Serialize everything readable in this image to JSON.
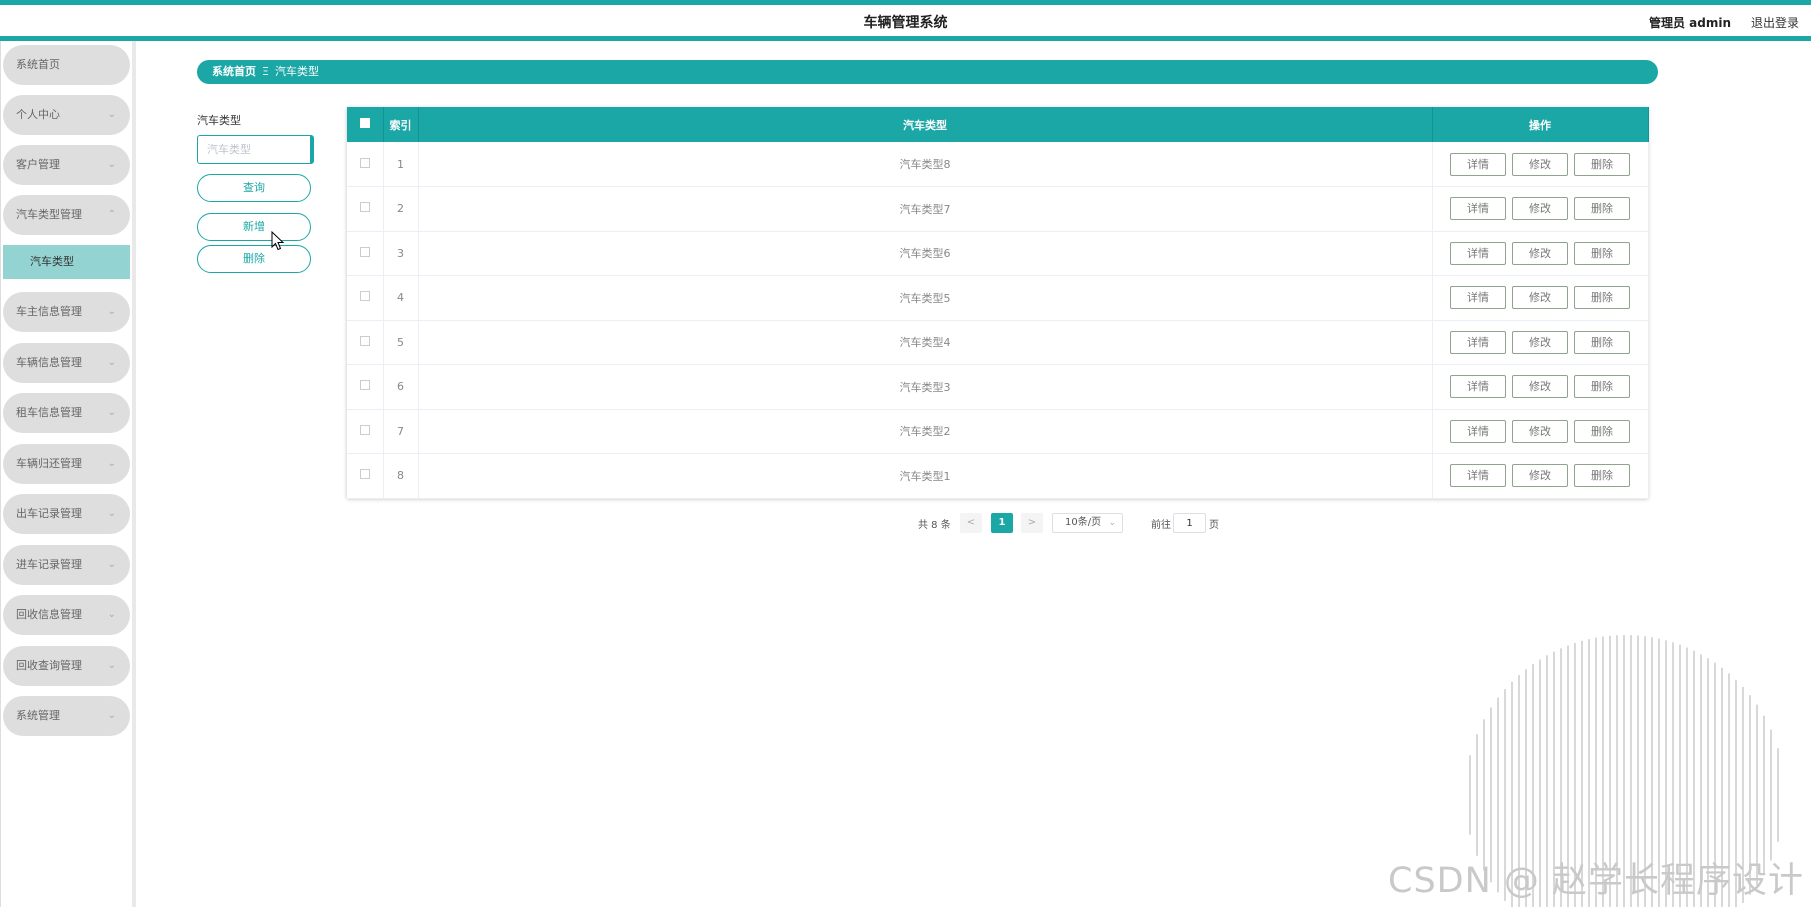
{
  "header": {
    "title": "车辆管理系统",
    "user": "管理员 admin",
    "logout": "退出登录"
  },
  "sidebar": {
    "items": [
      {
        "label": "系统首页"
      },
      {
        "label": "个人中心"
      },
      {
        "label": "客户管理"
      },
      {
        "label": "汽车类型管理"
      },
      {
        "label": "车主信息管理"
      },
      {
        "label": "车辆信息管理"
      },
      {
        "label": "租车信息管理"
      },
      {
        "label": "车辆归还管理"
      },
      {
        "label": "出车记录管理"
      },
      {
        "label": "进车记录管理"
      },
      {
        "label": "回收信息管理"
      },
      {
        "label": "回收查询管理"
      },
      {
        "label": "系统管理"
      }
    ],
    "sub_item": "汽车类型"
  },
  "breadcrumb": {
    "home": "系统首页",
    "separator": "Ξ",
    "current": "汽车类型"
  },
  "search": {
    "label": "汽车类型",
    "placeholder": "汽车类型",
    "query_button": "查询",
    "add_button": "新增",
    "delete_button": "删除"
  },
  "table": {
    "columns": {
      "index": "索引",
      "type": "汽车类型",
      "ops": "操作"
    },
    "rows": [
      {
        "index": "1",
        "type": "汽车类型8"
      },
      {
        "index": "2",
        "type": "汽车类型7"
      },
      {
        "index": "3",
        "type": "汽车类型6"
      },
      {
        "index": "4",
        "type": "汽车类型5"
      },
      {
        "index": "5",
        "type": "汽车类型4"
      },
      {
        "index": "6",
        "type": "汽车类型3"
      },
      {
        "index": "7",
        "type": "汽车类型2"
      },
      {
        "index": "8",
        "type": "汽车类型1"
      }
    ],
    "op_labels": {
      "detail": "详情",
      "edit": "修改",
      "delete": "删除"
    }
  },
  "pagination": {
    "total": "共 8 条",
    "prev": "<",
    "current_page": "1",
    "next": ">",
    "page_size": "10条/页",
    "goto_label": "前往",
    "goto_value": "1",
    "page_suffix": "页"
  },
  "watermark": "CSDN @ 赵学长程序设计",
  "colors": {
    "accent": "#1ba7a6",
    "sidebar_item": "#dedede",
    "sub_item": "#93d3d2"
  }
}
